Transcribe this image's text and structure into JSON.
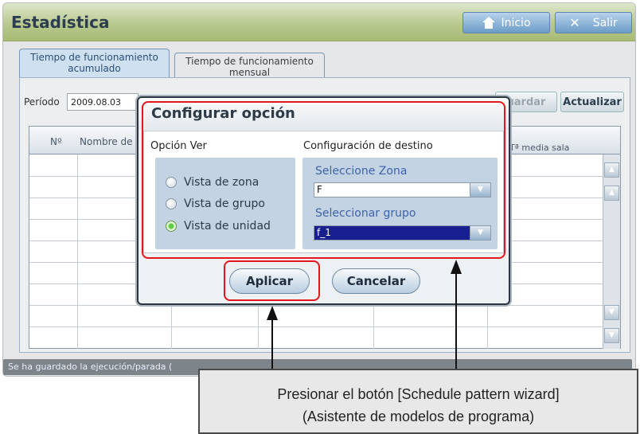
{
  "app": {
    "title": "Estadística",
    "home_label": "Inicio",
    "exit_label": "Salir"
  },
  "tabs": [
    {
      "line1": "Tiempo de funcionamiento",
      "line2": "acumulado",
      "active": true
    },
    {
      "line1": "Tiempo de funcionamiento",
      "line2": "mensual",
      "active": false
    }
  ],
  "toolbar": {
    "period_label": "Período",
    "period_value": "2009.08.03",
    "save_label": "uardar",
    "refresh_label": "Actualizar"
  },
  "table": {
    "headers": [
      "Nº",
      "Nombre de",
      "Tª media sala"
    ]
  },
  "statusbar": {
    "text": "Se ha guardado la ejecución/parada ("
  },
  "dialog": {
    "title": "Configurar opción",
    "view_section_label": "Opción Ver",
    "dest_section_label": "Configuración de destino",
    "view_options": [
      {
        "label": "Vista de zona",
        "selected": false
      },
      {
        "label": "Vista de grupo",
        "selected": false
      },
      {
        "label": "Vista de unidad",
        "selected": true
      }
    ],
    "zone_label": "Seleccione Zona",
    "zone_value": "F",
    "group_label": "Seleccionar grupo",
    "group_value": "f_1",
    "apply_label": "Aplicar",
    "cancel_label": "Cancelar"
  },
  "callout": {
    "line1": "Presionar el botón [Schedule pattern wizard]",
    "line2": "(Asistente de modelos de programa)"
  },
  "colors": {
    "highlight": "#e4151b",
    "title_bar": "#b9c98f",
    "selected_group": "#1a1f8f"
  }
}
